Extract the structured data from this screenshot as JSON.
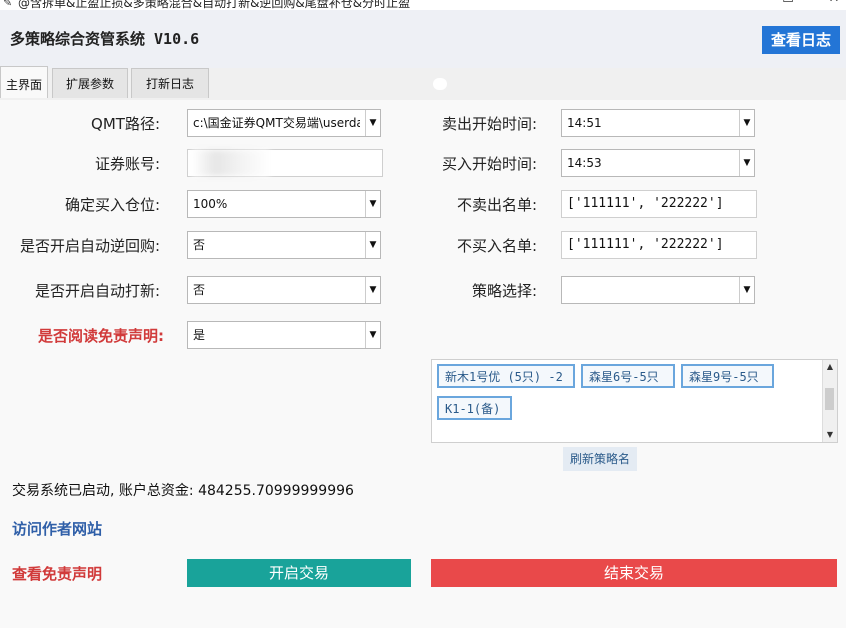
{
  "window": {
    "title": "@含拆单&止盈止损&多策略混合&自动打新&逆回购&尾盘补仓&分时止盈",
    "minimize": "—",
    "maximize": "☐",
    "close": "✕"
  },
  "header": {
    "app_title": "多策略综合资管系统 V10.6",
    "log_button": "查看日志"
  },
  "tabs": [
    "主界面",
    "扩展参数",
    "打新日志"
  ],
  "form_left": {
    "qmt_path": {
      "label": "QMT路径:",
      "value": "c:\\国金证券QMT交易端\\userda"
    },
    "account": {
      "label": "证券账号:",
      "value": ""
    },
    "position": {
      "label": "确定买入仓位:",
      "value": "100%"
    },
    "reverse_repo": {
      "label": "是否开启自动逆回购:",
      "value": "否"
    },
    "ipo": {
      "label": "是否开启自动打新:",
      "value": "否"
    },
    "disclaimer_read": {
      "label": "是否阅读免责声明:",
      "value": "是"
    }
  },
  "form_right": {
    "sell_start": {
      "label": "卖出开始时间:",
      "value": "14:51"
    },
    "buy_start": {
      "label": "买入开始时间:",
      "value": "14:53"
    },
    "no_sell": {
      "label": "不卖出名单:",
      "value": "['111111', '222222']"
    },
    "no_buy": {
      "label": "不买入名单:",
      "value": "['111111', '222222']"
    },
    "strategy": {
      "label": "策略选择:",
      "value": ""
    }
  },
  "strategies": [
    "新木1号优 (5只) -2",
    "森星6号-5只",
    "森星9号-5只",
    "K1-1(备)"
  ],
  "refresh_button": "刷新策略名",
  "status_text": "交易系统已启动, 账户总资金: 484255.70999999996",
  "visit_author": "访问作者网站",
  "view_disclaimer": "查看免责声明",
  "start_button": "开启交易",
  "stop_button": "结束交易",
  "colors": {
    "accent_blue": "#2375d6",
    "start_green": "#19a39a",
    "stop_red": "#e9494a",
    "warning_red": "#d13a3a"
  }
}
